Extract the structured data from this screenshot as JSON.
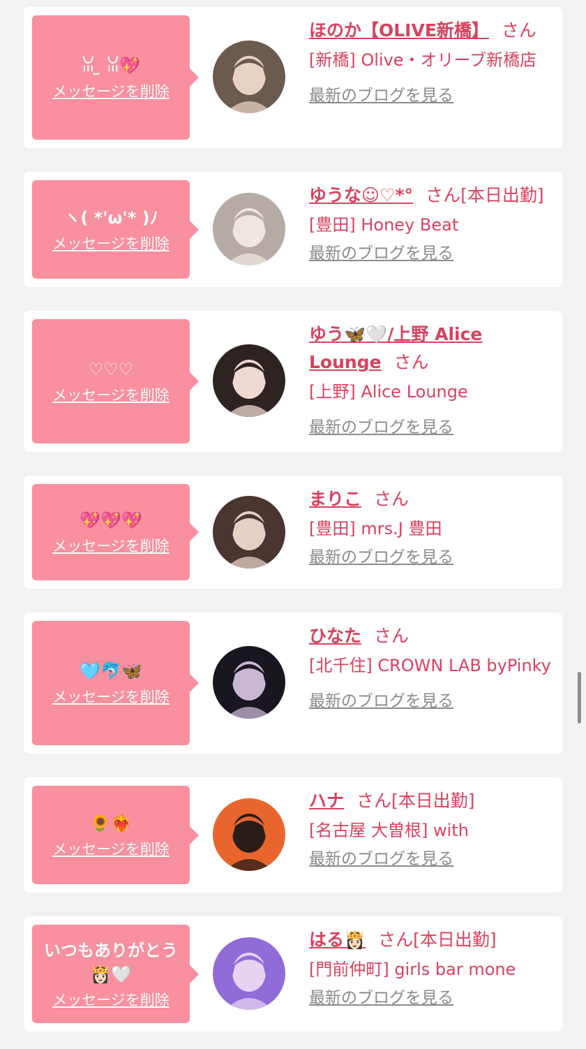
{
  "cards": [
    {
      "message": "ꈍ ̫ ꈍ💖",
      "delete_label": "メッセージを削除",
      "name": "ほのか【OLIVE新橋】",
      "honorific": "さん",
      "status": "",
      "shop": "[新橋] Olive・オリーブ新橋店",
      "blog_label": "最新のブログを見る",
      "avatar_colors": [
        "#6b5a4e",
        "#e8d2c3"
      ]
    },
    {
      "message": "ヽ( *'ω'* )ﾉ",
      "delete_label": "メッセージを削除",
      "name": "ゆうな☺︎♡*°",
      "honorific": "さん",
      "status": "[本日出勤]",
      "shop": "[豊田] Honey Beat",
      "blog_label": "最新のブログを見る",
      "avatar_colors": [
        "#b5aba4",
        "#efe6df"
      ]
    },
    {
      "message": "♡♡♡",
      "delete_label": "メッセージを削除",
      "name": "ゆう🦋🤍/上野 Alice Lounge",
      "honorific": "さん",
      "status": "",
      "shop": "[上野] Alice Lounge",
      "blog_label": "最新のブログを見る",
      "avatar_colors": [
        "#2d2422",
        "#f0d8d2"
      ]
    },
    {
      "message": "💖💖💖",
      "delete_label": "メッセージを削除",
      "name": "まりこ",
      "honorific": "さん",
      "status": "",
      "shop": "[豊田] mrs.J 豊田",
      "blog_label": "最新のブログを見る",
      "avatar_colors": [
        "#4a3530",
        "#e6cfc4"
      ]
    },
    {
      "message": "🩵🐬🦋",
      "delete_label": "メッセージを削除",
      "name": "ひなた",
      "honorific": "さん",
      "status": "",
      "shop": "[北千住] CROWN LAB byPinky",
      "blog_label": "最新のブログを見る",
      "avatar_colors": [
        "#1a1620",
        "#c9b7d6"
      ]
    },
    {
      "message": "🌻❤️‍🔥",
      "delete_label": "メッセージを削除",
      "name": "ハナ",
      "honorific": "さん",
      "status": "[本日出勤]",
      "shop": "[名古屋 大曽根] with",
      "blog_label": "最新のブログを見る",
      "avatar_colors": [
        "#e8662e",
        "#2a1c18"
      ]
    },
    {
      "message": "いつもありがとう👸🏻🤍",
      "delete_label": "メッセージを削除",
      "name": "はる👸🏻",
      "honorific": "さん",
      "status": "[本日出勤]",
      "shop": "[門前仲町] girls bar mone",
      "blog_label": "最新のブログを見る",
      "avatar_colors": [
        "#8f6cd8",
        "#e6d3f2"
      ]
    }
  ]
}
